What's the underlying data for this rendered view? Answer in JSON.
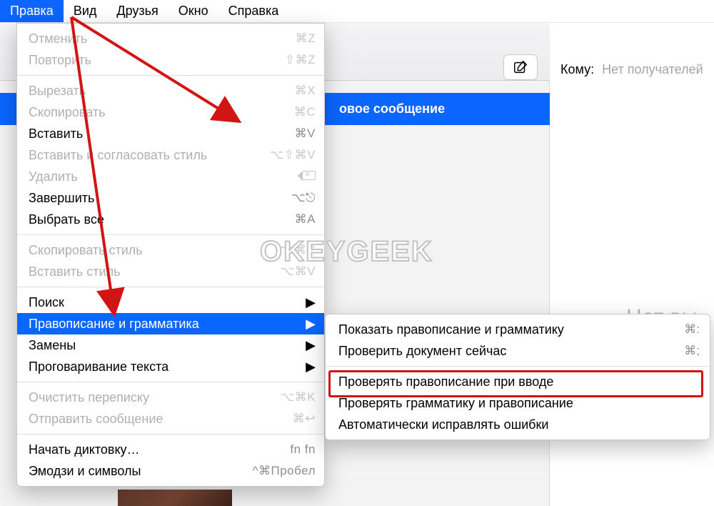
{
  "menubar": {
    "items": [
      {
        "label": "Правка",
        "active": true
      },
      {
        "label": "Вид"
      },
      {
        "label": "Друзья"
      },
      {
        "label": "Окно"
      },
      {
        "label": "Справка"
      }
    ]
  },
  "sidebar": {
    "selected_title": "овое сообщение"
  },
  "compose": {
    "to_label": "Кому:",
    "to_placeholder": "Нет получателей",
    "no_selection_text": "Нет вы"
  },
  "dropdown": {
    "items": [
      {
        "label": "Отменить",
        "shortcut": "⌘Z",
        "disabled": true
      },
      {
        "label": "Повторить",
        "shortcut": "⇧⌘Z",
        "disabled": true
      },
      {
        "sep": true
      },
      {
        "label": "Вырезать",
        "shortcut": "⌘X",
        "disabled": true
      },
      {
        "label": "Скопировать",
        "shortcut": "⌘C",
        "disabled": true
      },
      {
        "label": "Вставить",
        "shortcut": "⌘V"
      },
      {
        "label": "Вставить и согласовать стиль",
        "shortcut": "⌥⇧⌘V",
        "disabled": true
      },
      {
        "label": "Удалить",
        "shortcut": "delete-icon",
        "disabled": true
      },
      {
        "label": "Завершить",
        "shortcut": "⌥⎋"
      },
      {
        "label": "Выбрать все",
        "shortcut": "⌘A"
      },
      {
        "sep": true
      },
      {
        "label": "Скопировать стиль",
        "shortcut": "⌥⌘C",
        "disabled": true
      },
      {
        "label": "Вставить стиль",
        "shortcut": "⌥⌘V",
        "disabled": true
      },
      {
        "sep": true
      },
      {
        "label": "Поиск",
        "submenu": true
      },
      {
        "label": "Правописание и грамматика",
        "submenu": true,
        "highlight": true
      },
      {
        "label": "Замены",
        "submenu": true
      },
      {
        "label": "Проговаривание текста",
        "submenu": true
      },
      {
        "sep": true
      },
      {
        "label": "Очистить переписку",
        "shortcut": "⌥⌘K",
        "disabled": true
      },
      {
        "label": "Отправить сообщение",
        "shortcut": "⌘↩",
        "disabled": true
      },
      {
        "sep": true
      },
      {
        "label": "Начать диктовку…",
        "shortcut": "fn fn"
      },
      {
        "label": "Эмодзи и символы",
        "shortcut": "^⌘Пробел"
      }
    ]
  },
  "submenu": {
    "items": [
      {
        "label": "Показать правописание и грамматику",
        "shortcut": "⌘:"
      },
      {
        "label": "Проверить документ сейчас",
        "shortcut": "⌘;"
      },
      {
        "sep": true
      },
      {
        "label": "Проверять правописание при вводе",
        "boxed": true
      },
      {
        "label": "Проверять грамматику и правописание"
      },
      {
        "label": "Автоматически исправлять ошибки"
      }
    ]
  },
  "watermark": "OKEYGEEK"
}
